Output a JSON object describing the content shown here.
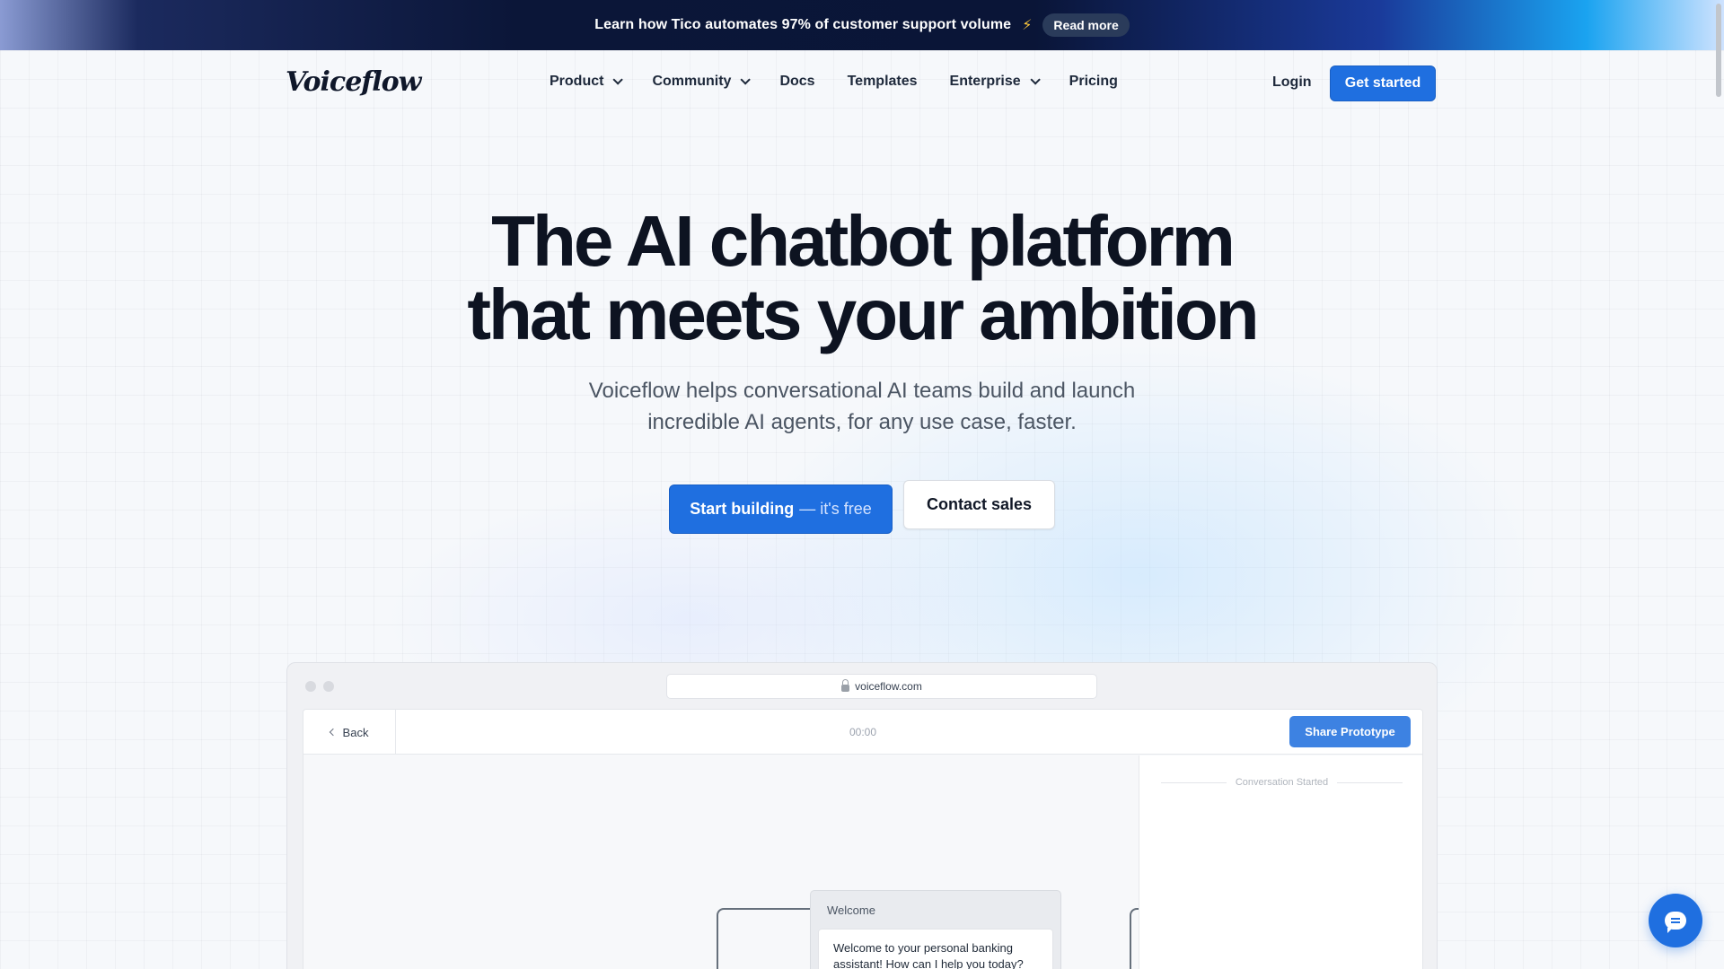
{
  "banner": {
    "text": "Learn how Tico automates 97% of customer support volume",
    "emoji": "⚡",
    "button": "Read more"
  },
  "nav": {
    "logo": "Voiceflow",
    "items": [
      {
        "label": "Product",
        "dropdown": true
      },
      {
        "label": "Community",
        "dropdown": true
      },
      {
        "label": "Docs",
        "dropdown": false
      },
      {
        "label": "Templates",
        "dropdown": false
      },
      {
        "label": "Enterprise",
        "dropdown": true
      },
      {
        "label": "Pricing",
        "dropdown": false
      }
    ],
    "login": "Login",
    "cta": "Get started"
  },
  "hero": {
    "title_line1": "The AI chatbot platform",
    "title_line2": "that meets your ambition",
    "subtitle_line1": "Voiceflow helps conversational AI teams build and launch",
    "subtitle_line2": "incredible AI agents, for any use case, faster.",
    "primary_cta": "Start building",
    "primary_cta_suffix": "— it's free",
    "secondary_cta": "Contact sales"
  },
  "mockup": {
    "url": "voiceflow.com",
    "back": "Back",
    "timer": "00:00",
    "share": "Share Prototype",
    "conversation_started": "Conversation Started",
    "block_title": "Welcome",
    "block_text": "Welcome to your personal banking assistant! How can I help you today?"
  },
  "colors": {
    "accent": "#1f6fe0",
    "banner_bg": "#0b1638",
    "text_dark": "#0d1321"
  },
  "icons": [
    "chevron-down-icon",
    "lock-icon",
    "chevron-left-icon",
    "chat-bubble-icon"
  ]
}
